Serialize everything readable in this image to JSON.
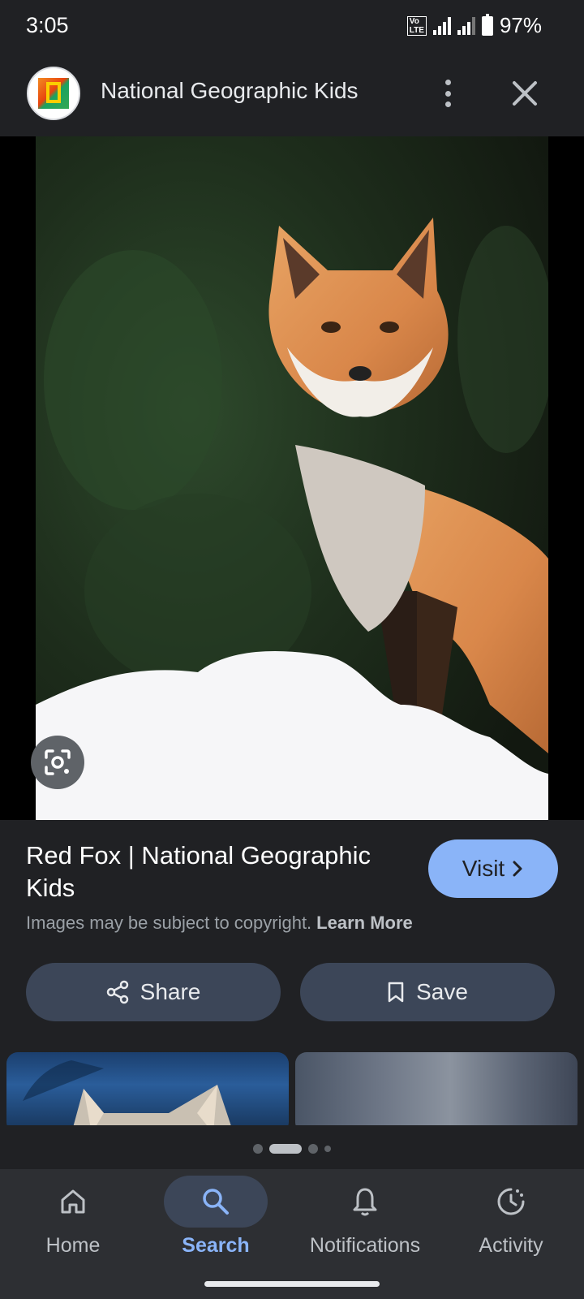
{
  "status_bar": {
    "time": "3:05",
    "network": "VoLTE2 4G",
    "battery": "97%"
  },
  "header": {
    "site_name": "National Geographic Kids",
    "logo_icon": "natgeo-kids-logo",
    "more_icon": "more-vert-icon",
    "close_icon": "close-icon"
  },
  "image": {
    "subject": "red-fox-photo",
    "lens_icon": "google-lens-icon"
  },
  "result": {
    "title": "Red Fox | National Geographic Kids",
    "visit_label": "Visit",
    "copyright_text": "Images may be subject to copyright.",
    "learn_more_label": "Learn More"
  },
  "actions": {
    "share_label": "Share",
    "save_label": "Save"
  },
  "pagination": {
    "dots": 4,
    "active_index": 1
  },
  "bottom_nav": {
    "items": [
      {
        "label": "Home",
        "icon": "home-icon",
        "active": false
      },
      {
        "label": "Search",
        "icon": "search-icon",
        "active": true
      },
      {
        "label": "Notifications",
        "icon": "bell-icon",
        "active": false
      },
      {
        "label": "Activity",
        "icon": "activity-icon",
        "active": false
      }
    ]
  },
  "colors": {
    "background": "#202124",
    "accent": "#8ab4f8",
    "button_bg": "#3c4658",
    "nav_bg": "#2d2f33"
  }
}
